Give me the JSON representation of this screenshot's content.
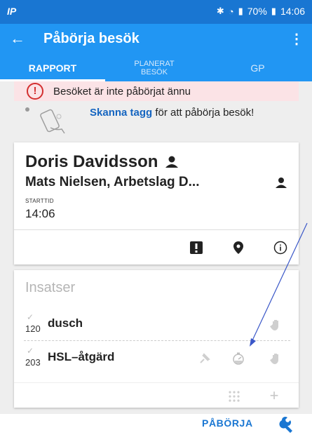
{
  "status": {
    "carrier": "IP",
    "battery": "70%",
    "time": "14:06"
  },
  "appbar": {
    "title": "Påbörja besök"
  },
  "tabs": [
    {
      "label": "RAPPORT"
    },
    {
      "label_line1": "PLANERAT",
      "label_line2": "BESÖK"
    },
    {
      "label": "GP"
    }
  ],
  "alert": {
    "text": "Besöket är inte påbörjat ännu"
  },
  "scan": {
    "link": "Skanna tagg",
    "text": "för att påbörja besök!"
  },
  "visit": {
    "client": "Doris Davidsson",
    "worker": "Mats Nielsen, Arbetslag D...",
    "start_label": "STARTTID",
    "start_time": "14:06"
  },
  "insatser": {
    "title": "Insatser",
    "items": [
      {
        "code": "120",
        "label": "dusch"
      },
      {
        "code": "203",
        "label": "HSL–åtgärd"
      }
    ]
  },
  "bottom": {
    "start_label": "PÅBÖRJA"
  },
  "colors": {
    "primary": "#2196f3",
    "statusbar": "#1976d2",
    "alert_bg": "#fbe3e6",
    "alert_icon": "#d32f2f",
    "accent_text": "#1565c0"
  }
}
